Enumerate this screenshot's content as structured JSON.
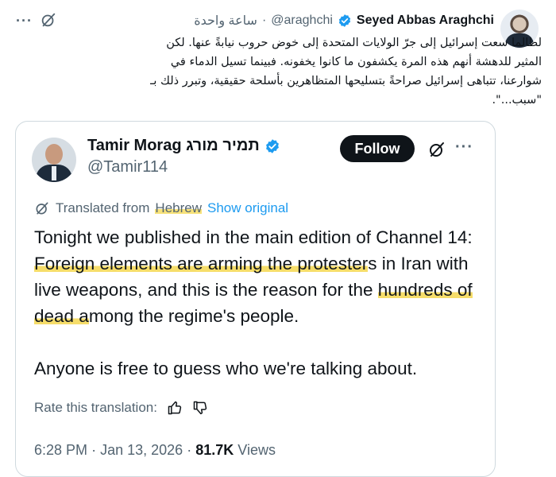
{
  "outer_tweet": {
    "author_name": "Seyed Abbas Araghchi",
    "handle": "@araghchi",
    "separator": "·",
    "timestamp": "ساعة واحدة",
    "text_lines": [
      "لطالما سعت إسرائيل إلى جرّ الولايات المتحدة إلى خوض حروب نيابةً عنها. لكن",
      "المثير للدهشة أنهم هذه المرة يكشفون ما كانوا يخفونه. فبينما تسيل الدماء في",
      "شوارعنا، تتباهى إسرائيل صراحةً بتسليحها المتظاهرين بأسلحة حقيقية، وتبرر ذلك بـ",
      "\"سبب...\"."
    ],
    "more_label": "···",
    "icons": [
      "verified-badge-icon",
      "grok-slash-icon",
      "more-icon"
    ]
  },
  "quoted_tweet": {
    "author_name": "Tamir Morag תמיר מורג",
    "handle": "@Tamir114",
    "follow_label": "Follow",
    "more_label": "···",
    "translated_prefix": "Translated from",
    "translated_language": "Hebrew",
    "show_original": "Show original",
    "body_before": "Tonight we published in the main edition of Channel 14: ",
    "body_hl1": "Foreign elements are arming the protester",
    "body_mid": "s in Iran with live weapons, and this is the reason for the ",
    "body_hl2": "hundreds of dead a",
    "body_after": "mong the regime's people.",
    "body_para2": "Anyone is free to guess who we're talking about.",
    "rate_label": "Rate this translation:",
    "time": "6:28 PM",
    "meta_sep": "·",
    "date": "Jan 13, 2026",
    "views_count": "81.7K",
    "views_label": "Views",
    "icons": [
      "translate-icon",
      "thumbs-up-icon",
      "thumbs-down-icon"
    ]
  },
  "colors": {
    "link": "#1d9bf0",
    "secondary_text": "#536471",
    "primary_text": "#0f1419",
    "highlight": "#f6dd6a",
    "border": "#cfd9de"
  }
}
